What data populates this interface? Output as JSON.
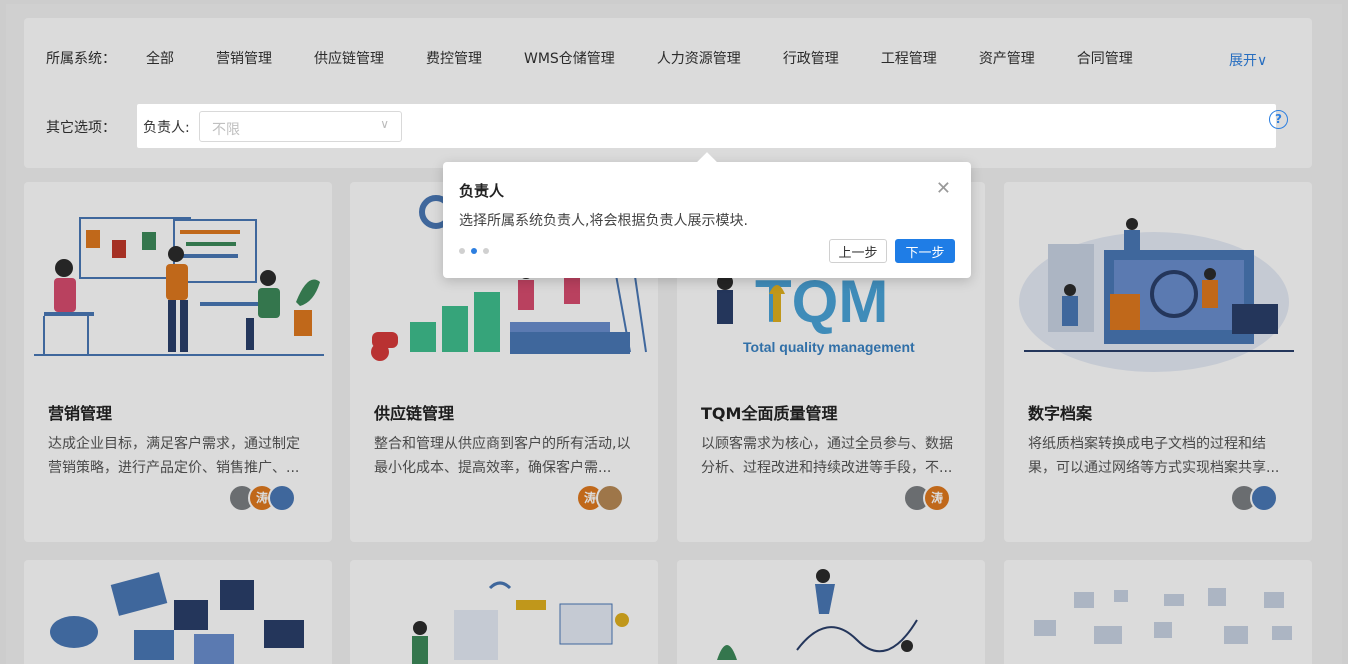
{
  "filters": {
    "system_label": "所属系统：",
    "systems": [
      "全部",
      "营销管理",
      "供应链管理",
      "费控管理",
      "WMS仓储管理",
      "人力资源管理",
      "行政管理",
      "工程管理",
      "资产管理",
      "合同管理"
    ],
    "expand_label": "展开∨",
    "other_label": "其它选项：",
    "owner_label": "负责人:",
    "owner_placeholder": "不限"
  },
  "popover": {
    "title": "负责人",
    "body": "选择所属系统负责人,将会根据负责人展示模块.",
    "prev_label": "上一步",
    "next_label": "下一步",
    "step_total": 3,
    "step_current": 2
  },
  "cards": [
    {
      "title": "营销管理",
      "desc": "达成企业目标，满足客户需求，通过制定营销策略，进行产品定价、销售推广、...",
      "avatars": [
        "gray",
        "涛",
        "blue"
      ]
    },
    {
      "title": "供应链管理",
      "desc": "整合和管理从供应商到客户的所有活动,以最小化成本、提高效率，确保客户需...",
      "avatars": [
        "涛",
        "tan"
      ]
    },
    {
      "title": "TQM全面质量管理",
      "desc": "以顾客需求为核心，通过全员参与、数据分析、过程改进和持续改进等手段，不...",
      "illus_text": "Total quality management",
      "avatars": [
        "gray",
        "涛"
      ]
    },
    {
      "title": "数字档案",
      "desc": "将纸质档案转换成电子文档的过程和结果，可以通过网络等方式实现档案共享...",
      "avatars": [
        "gray",
        "blue"
      ]
    }
  ],
  "colors": {
    "accent": "#2d7fe0",
    "avatar_orange": "#e07a1f"
  }
}
